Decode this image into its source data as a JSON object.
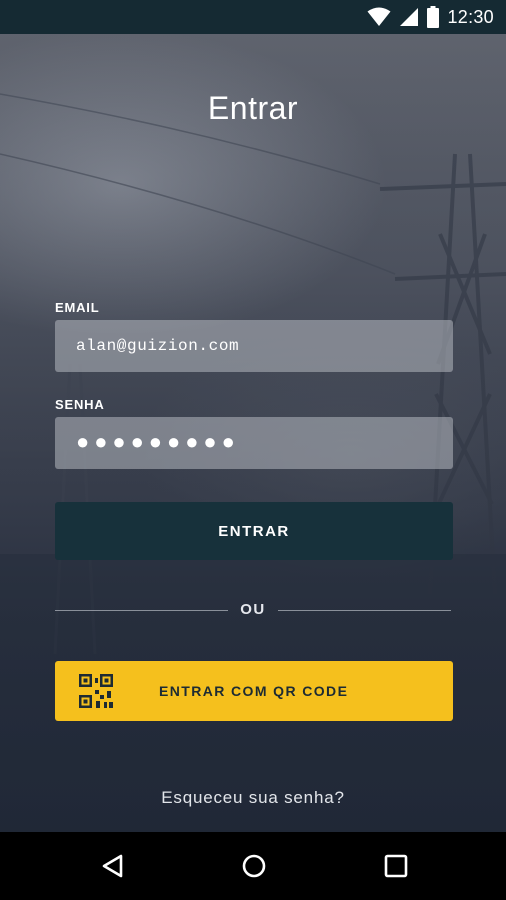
{
  "status_bar": {
    "time": "12:30",
    "icons": [
      "wifi-icon",
      "signal-icon",
      "battery-icon"
    ]
  },
  "login": {
    "title": "Entrar",
    "email": {
      "label": "EMAIL",
      "value": "alan@guizion.com"
    },
    "password": {
      "label": "SENHA",
      "value": "●●●●●●●●●"
    },
    "enter_button": "ENTRAR",
    "divider_text": "OU",
    "qr_button": {
      "label": "ENTRAR COM QR CODE",
      "icon": "qr-code-icon"
    },
    "forgot_link": "Esqueceu sua senha?"
  },
  "nav_bar": {
    "icons": [
      "back-icon",
      "home-icon",
      "recents-icon"
    ]
  },
  "colors": {
    "status_bar": "#152a33",
    "enter_button": "#17313b",
    "qr_button": "#f5c01d",
    "field_bg": "rgba(180,184,192,0.55)",
    "nav_bar": "#000000"
  }
}
